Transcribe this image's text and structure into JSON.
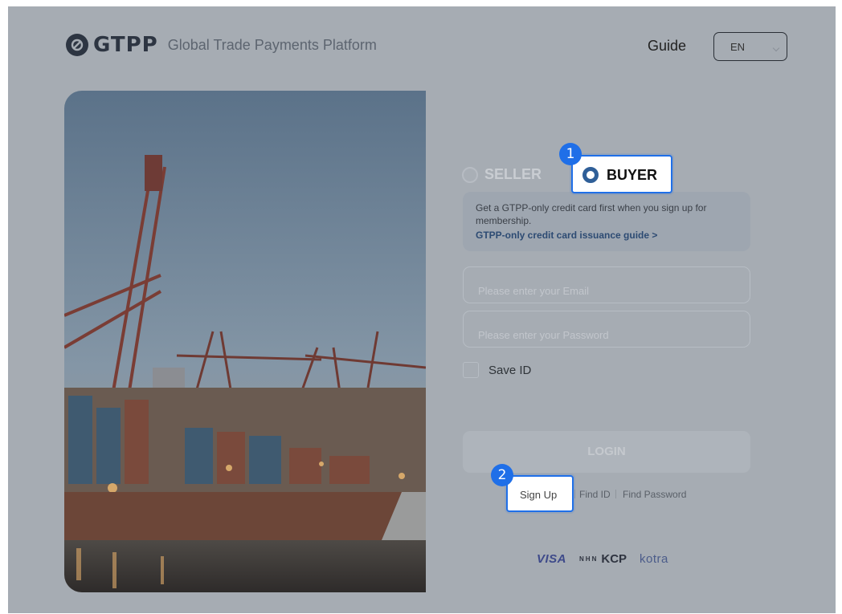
{
  "header": {
    "logo_text": "GTPP",
    "platform_name": "Global Trade Payments Platform",
    "guide_label": "Guide",
    "language": "EN"
  },
  "user_type": {
    "seller_label": "SELLER",
    "buyer_label": "BUYER",
    "selected": "BUYER"
  },
  "info": {
    "message": "Get a GTPP-only credit card first when you sign up for membership.",
    "link_label": "GTPP-only credit card issuance guide >"
  },
  "form": {
    "email_placeholder": "Please enter your Email",
    "password_placeholder": "Please enter your Password",
    "save_id_label": "Save ID",
    "save_id_checked": false,
    "login_label": "LOGIN"
  },
  "links": {
    "sign_up": "Sign Up",
    "find_id": "Find ID",
    "find_password": "Find Password"
  },
  "partners": {
    "visa": "VISA",
    "nhn": "NHN",
    "kcp": "KCP",
    "kotra": "kotra"
  },
  "annotations": {
    "step1": "1",
    "step2": "2"
  },
  "colors": {
    "overlay": "#a6acb3",
    "highlight_border": "#1f6fe8",
    "badge": "#1f6fe8",
    "logo": "#2d3542"
  }
}
